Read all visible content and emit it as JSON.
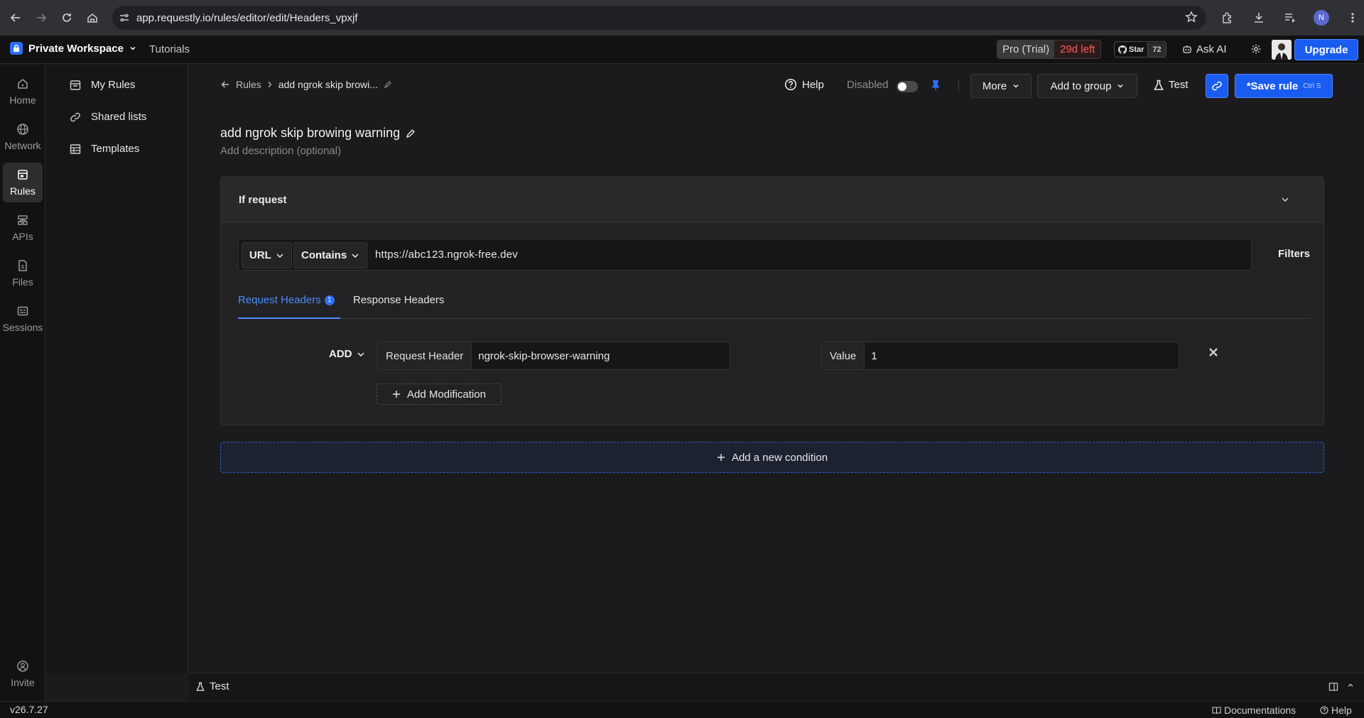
{
  "browser": {
    "url": "app.requestly.io/rules/editor/edit/Headers_vpxjf",
    "profile_initial": "N"
  },
  "appbar": {
    "workspace": "Private Workspace",
    "tutorials": "Tutorials",
    "plan": "Pro (Trial)",
    "trial_left": "29d left",
    "github_star": "Star",
    "github_count": "72",
    "ask_ai": "Ask AI",
    "upgrade": "Upgrade"
  },
  "rail": {
    "home": "Home",
    "network": "Network",
    "rules": "Rules",
    "apis": "APIs",
    "files": "Files",
    "sessions": "Sessions",
    "invite": "Invite"
  },
  "secnav": {
    "my_rules": "My Rules",
    "shared_lists": "Shared lists",
    "templates": "Templates"
  },
  "toolbar": {
    "breadcrumb_root": "Rules",
    "breadcrumb_current": "add ngrok skip browi...",
    "help": "Help",
    "status": "Disabled",
    "more": "More",
    "add_to_group": "Add to group",
    "test": "Test",
    "save": "*Save rule",
    "save_shortcut": "Ctrl S"
  },
  "rule": {
    "title": "add ngrok skip browing warning",
    "description_placeholder": "Add description (optional)"
  },
  "condition": {
    "header": "If request",
    "source_key": "URL",
    "operator": "Contains",
    "url_value": "https://abc123.ngrok-free.dev",
    "filters": "Filters",
    "tabs": {
      "request_headers": "Request Headers",
      "request_count": "1",
      "response_headers": "Response Headers"
    },
    "modification": {
      "action": "ADD",
      "header_label": "Request Header",
      "header_value": "ngrok-skip-browser-warning",
      "value_label": "Value",
      "value": "1"
    },
    "add_modification": "Add Modification"
  },
  "add_condition": "Add a new condition",
  "bottom_panel": {
    "test": "Test"
  },
  "footer": {
    "version": "v26.7.27",
    "documentation": "Documentations",
    "help": "Help"
  }
}
